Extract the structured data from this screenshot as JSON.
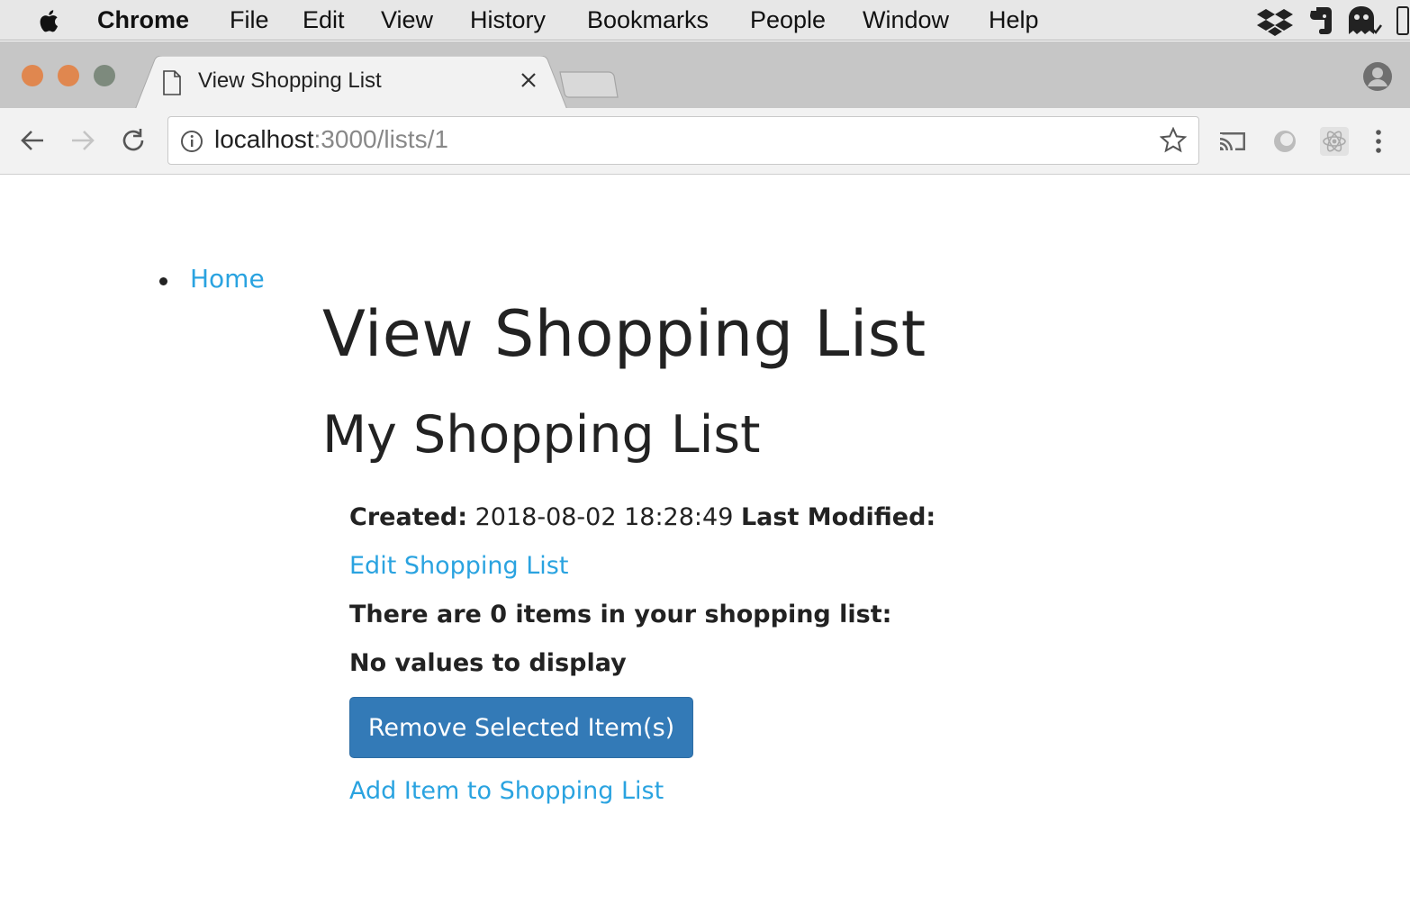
{
  "menubar": {
    "items": [
      "Chrome",
      "File",
      "Edit",
      "View",
      "History",
      "Bookmarks",
      "People",
      "Window",
      "Help"
    ],
    "status_icons": [
      "dropbox-icon",
      "evernote-icon",
      "ghost-icon",
      "battery-icon"
    ]
  },
  "browser": {
    "tab_title": "View Shopping List",
    "url_host": "localhost",
    "url_rest": ":3000/lists/1"
  },
  "page": {
    "nav_home": "Home",
    "heading": "View Shopping List",
    "list_name": "My Shopping List",
    "created_label": "Created:",
    "created_value": "2018-08-02 18:28:49",
    "modified_label": "Last Modified:",
    "edit_link": "Edit Shopping List",
    "count_text": "There are 0 items in your shopping list:",
    "empty_text": "No values to display",
    "remove_button": "Remove Selected Item(s)",
    "add_link": "Add Item to Shopping List"
  },
  "colors": {
    "link": "#2aa3e0",
    "button": "#337ab7",
    "close_dot": "#e0874f",
    "min_dot": "#e0874f",
    "max_dot": "#7d8a7d"
  }
}
